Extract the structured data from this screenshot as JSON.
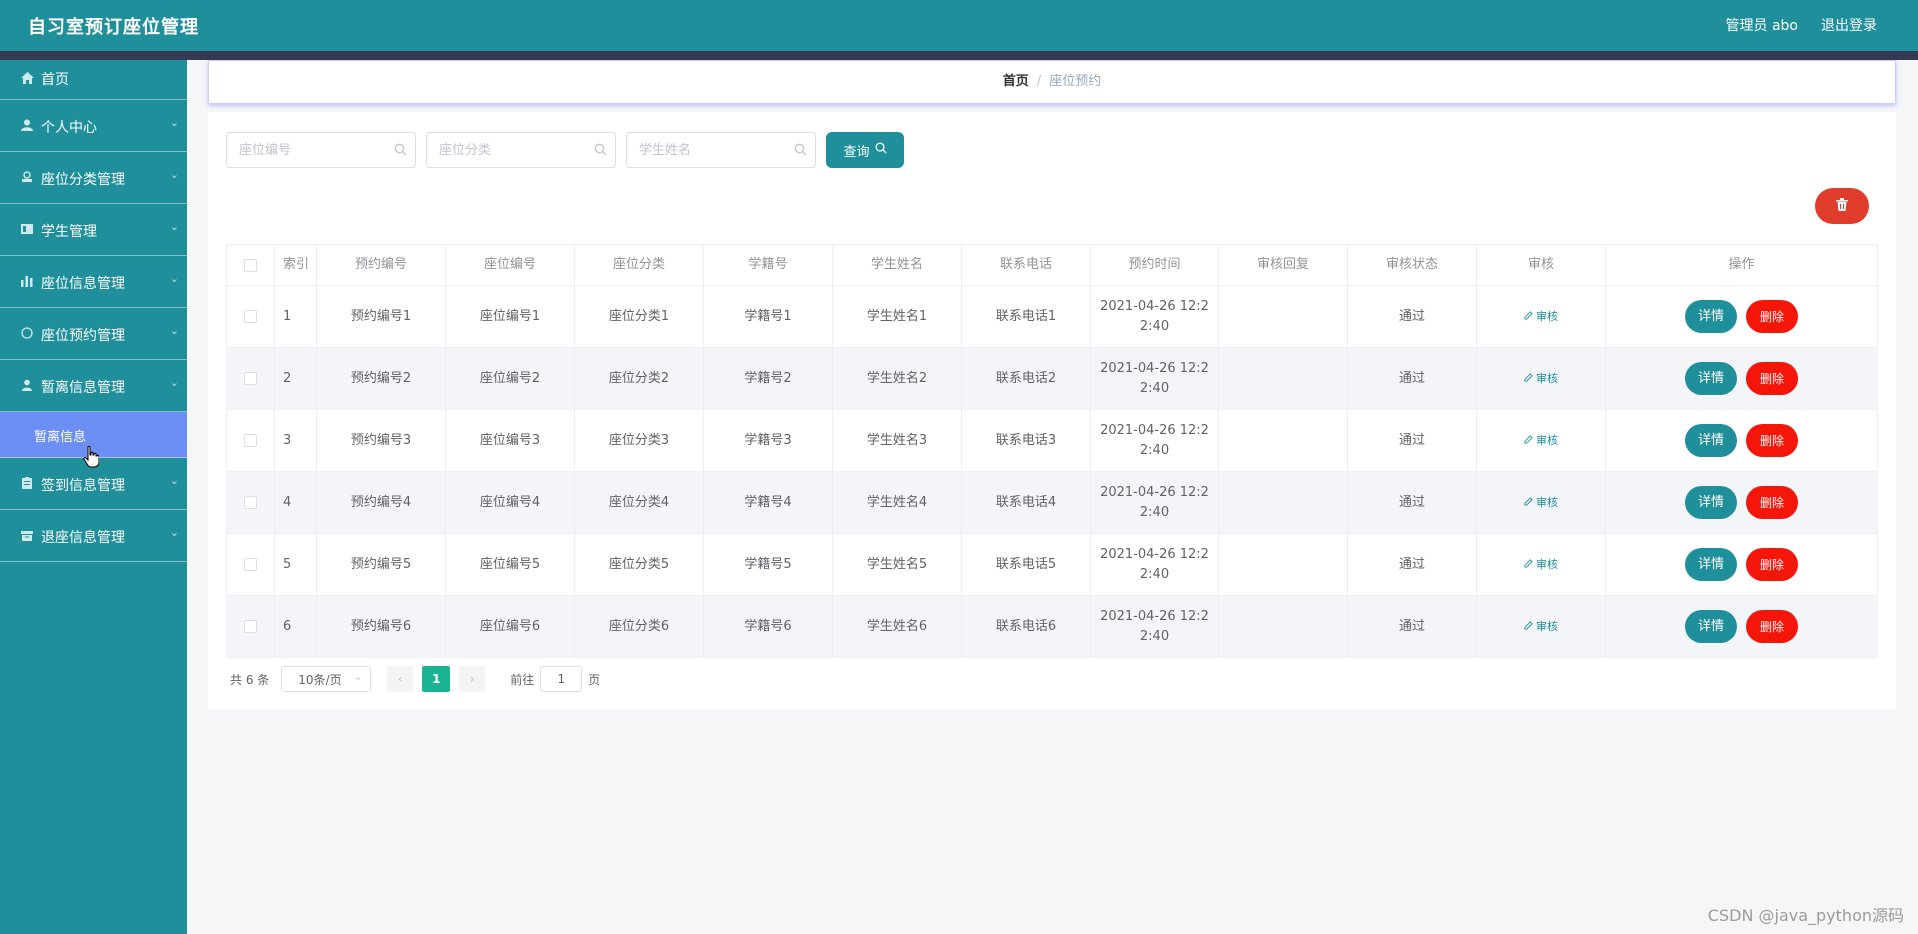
{
  "app_title": "自习室预订座位管理",
  "header": {
    "user": "管理员 abo",
    "logout": "退出登录"
  },
  "sidebar": {
    "items": [
      {
        "label": "首页",
        "icon": "home-icon"
      },
      {
        "label": "个人中心",
        "icon": "user-icon"
      },
      {
        "label": "座位分类管理",
        "icon": "category-icon"
      },
      {
        "label": "学生管理",
        "icon": "student-icon"
      },
      {
        "label": "座位信息管理",
        "icon": "chart-icon"
      },
      {
        "label": "座位预约管理",
        "icon": "clock-icon"
      },
      {
        "label": "暂离信息管理",
        "icon": "user-away-icon"
      },
      {
        "label": "签到信息管理",
        "icon": "clipboard-icon"
      },
      {
        "label": "退座信息管理",
        "icon": "box-icon"
      }
    ],
    "submenu": {
      "label": "暂离信息"
    }
  },
  "breadcrumb": {
    "home": "首页",
    "separator": "/",
    "current": "座位预约"
  },
  "search": {
    "seat_no_placeholder": "座位编号",
    "seat_category_placeholder": "座位分类",
    "student_name_placeholder": "学生姓名",
    "query_label": "查询"
  },
  "table": {
    "columns": [
      "索引",
      "预约编号",
      "座位编号",
      "座位分类",
      "学籍号",
      "学生姓名",
      "联系电话",
      "预约时间",
      "审核回复",
      "审核状态",
      "审核",
      "操作"
    ],
    "rows": [
      {
        "index": "1",
        "booking_no": "预约编号1",
        "seat_no": "座位编号1",
        "category": "座位分类1",
        "student_id": "学籍号1",
        "name": "学生姓名1",
        "phone": "联系电话1",
        "time_line1": "2021-04-26 12:2",
        "time_line2": "2:40",
        "reply": "",
        "status": "通过"
      },
      {
        "index": "2",
        "booking_no": "预约编号2",
        "seat_no": "座位编号2",
        "category": "座位分类2",
        "student_id": "学籍号2",
        "name": "学生姓名2",
        "phone": "联系电话2",
        "time_line1": "2021-04-26 12:2",
        "time_line2": "2:40",
        "reply": "",
        "status": "通过"
      },
      {
        "index": "3",
        "booking_no": "预约编号3",
        "seat_no": "座位编号3",
        "category": "座位分类3",
        "student_id": "学籍号3",
        "name": "学生姓名3",
        "phone": "联系电话3",
        "time_line1": "2021-04-26 12:2",
        "time_line2": "2:40",
        "reply": "",
        "status": "通过"
      },
      {
        "index": "4",
        "booking_no": "预约编号4",
        "seat_no": "座位编号4",
        "category": "座位分类4",
        "student_id": "学籍号4",
        "name": "学生姓名4",
        "phone": "联系电话4",
        "time_line1": "2021-04-26 12:2",
        "time_line2": "2:40",
        "reply": "",
        "status": "通过"
      },
      {
        "index": "5",
        "booking_no": "预约编号5",
        "seat_no": "座位编号5",
        "category": "座位分类5",
        "student_id": "学籍号5",
        "name": "学生姓名5",
        "phone": "联系电话5",
        "time_line1": "2021-04-26 12:2",
        "time_line2": "2:40",
        "reply": "",
        "status": "通过"
      },
      {
        "index": "6",
        "booking_no": "预约编号6",
        "seat_no": "座位编号6",
        "category": "座位分类6",
        "student_id": "学籍号6",
        "name": "学生姓名6",
        "phone": "联系电话6",
        "time_line1": "2021-04-26 12:2",
        "time_line2": "2:40",
        "reply": "",
        "status": "通过"
      }
    ],
    "audit_label": "审核",
    "detail_label": "详情",
    "delete_label": "删除"
  },
  "pagination": {
    "total": "共 6 条",
    "page_size": "10条/页",
    "current_page": "1",
    "goto_prefix": "前往",
    "goto_value": "1",
    "goto_suffix": "页"
  },
  "watermark": "CSDN @java_python源码",
  "colors": {
    "primary": "#1f8f9b",
    "danger": "#f5160a",
    "active_submenu": "#6c8ff5",
    "pager_active": "#1ab394"
  }
}
